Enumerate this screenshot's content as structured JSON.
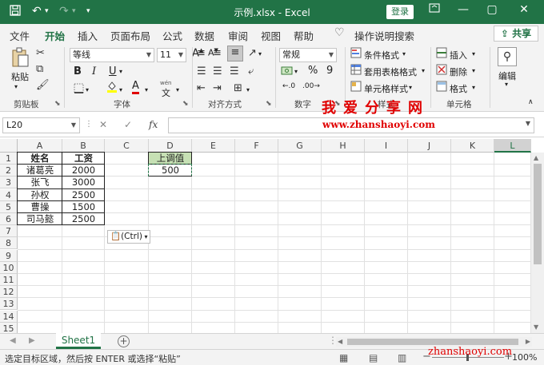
{
  "titlebar": {
    "title": "示例.xlsx  -  Excel",
    "login_label": "登录",
    "save_icon": "save-icon",
    "undo_icon": "undo-icon",
    "redo_icon": "redo-icon"
  },
  "menu": {
    "tabs": [
      "文件",
      "开始",
      "插入",
      "页面布局",
      "公式",
      "数据",
      "审阅",
      "视图",
      "帮助"
    ],
    "active_tab": "开始",
    "tell_me": "操作说明搜索",
    "share_label": "共享"
  },
  "ribbon": {
    "clipboard": {
      "paste_label": "粘贴",
      "group_label": "剪贴板"
    },
    "font": {
      "name": "等线",
      "size": "11",
      "group_label": "字体",
      "bold": "B",
      "italic": "I",
      "underline": "U",
      "font_color_glyph": "A",
      "phonetic_glyph": "wén"
    },
    "alignment": {
      "group_label": "对齐方式"
    },
    "number": {
      "format": "常规",
      "group_label": "数字",
      "percent": "%",
      "comma": "9"
    },
    "styles": {
      "conditional_format": "条件格式",
      "format_as_table": "套用表格格式",
      "cell_styles": "单元格样式",
      "group_label": "样式"
    },
    "cells": {
      "insert": "插入",
      "delete": "删除",
      "format": "格式",
      "group_label": "单元格"
    },
    "editing": {
      "group_label": "编辑"
    }
  },
  "formula_bar": {
    "name_box": "L20",
    "formula": "",
    "fx_label": "fx"
  },
  "watermark": {
    "title": "我爱分享网",
    "url": "www.zhanshaoyi.com",
    "url_footer": "zhanshaoyi.com"
  },
  "sheet": {
    "columns": [
      "A",
      "B",
      "C",
      "D",
      "E",
      "F",
      "G",
      "H",
      "I",
      "J",
      "K",
      "L"
    ],
    "selected_column": "L",
    "rows": [
      "1",
      "2",
      "3",
      "4",
      "5",
      "6",
      "7",
      "8",
      "9",
      "10",
      "11",
      "12",
      "13",
      "14",
      "15"
    ],
    "headers": {
      "name": "姓名",
      "salary": "工资",
      "adjust": "上调值"
    },
    "names": [
      "诸葛亮",
      "张飞",
      "孙权",
      "曹操",
      "司马懿"
    ],
    "salaries": [
      "2000",
      "3000",
      "2500",
      "1500",
      "2500"
    ],
    "adjust_value": "500",
    "paste_options_label": "(Ctrl)"
  },
  "sheet_tabs": {
    "tabs": [
      "Sheet1"
    ],
    "active": "Sheet1",
    "add_label": "+"
  },
  "statusbar": {
    "message": "选定目标区域，然后按 ENTER 或选择“粘贴”",
    "zoom": "100%",
    "zoom_level": 1.0
  },
  "colors": {
    "accent": "#217346",
    "header_fill": "#c6e0b4",
    "watermark": "#e00000"
  }
}
